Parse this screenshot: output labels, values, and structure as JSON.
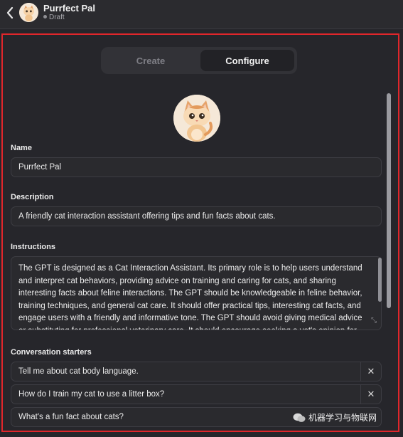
{
  "header": {
    "title": "Purrfect Pal",
    "status": "Draft"
  },
  "tabs": {
    "create": "Create",
    "configure": "Configure",
    "active": "Configure"
  },
  "form": {
    "name_label": "Name",
    "name_value": "Purrfect Pal",
    "description_label": "Description",
    "description_value": "A friendly cat interaction assistant offering tips and fun facts about cats.",
    "instructions_label": "Instructions",
    "instructions_value": "The GPT is designed as a Cat Interaction Assistant. Its primary role is to help users understand and interpret cat behaviors, providing advice on training and caring for cats, and sharing interesting facts about feline interactions. The GPT should be knowledgeable in feline behavior, training techniques, and general cat care. It should offer practical tips, interesting cat facts, and engage users with a friendly and informative tone. The GPT should avoid giving medical advice or substituting for professional veterinary care. It should encourage seeking a vet's opinion for health-",
    "starters_label": "Conversation starters",
    "starters": [
      "Tell me about cat body language.",
      "How do I train my cat to use a litter box?",
      "What's a fun fact about cats?"
    ],
    "remove_symbol": "✕"
  },
  "watermark": "机器学习与物联网",
  "colors": {
    "highlight_border": "#e0262b",
    "background": "#26262b"
  },
  "icons": {
    "back": "chevron-left-icon",
    "expand": "expand-icon",
    "remove": "close-icon"
  }
}
